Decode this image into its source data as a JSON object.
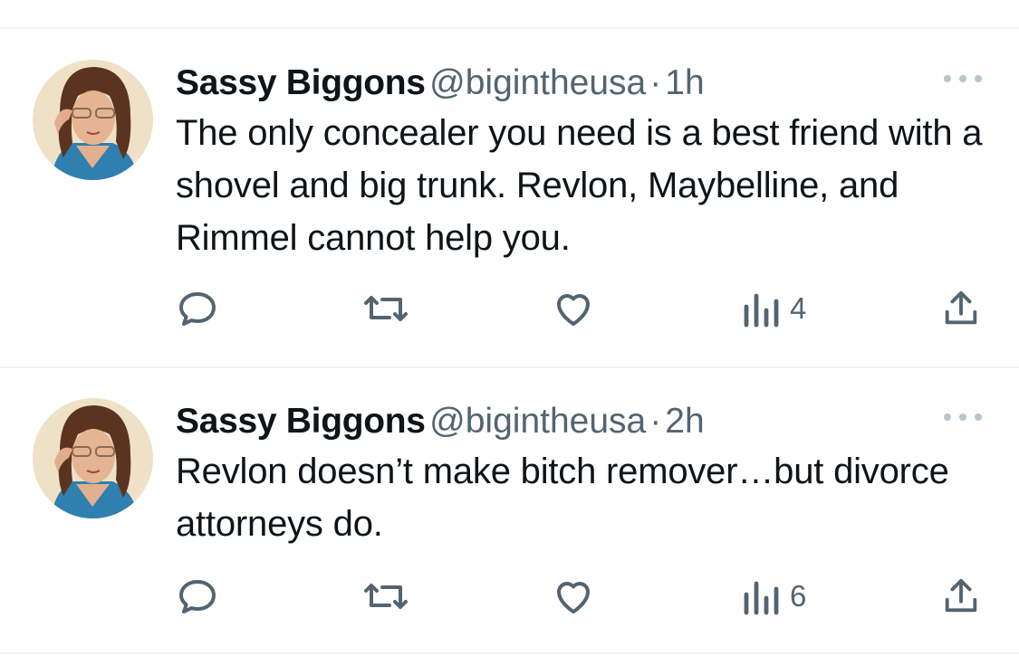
{
  "tweets": [
    {
      "author": "Sassy Biggons",
      "handle": "@bigintheusa",
      "separator": "·",
      "time": "1h",
      "text": "The only concealer you need is a best friend with a shovel and big trunk. Revlon, Maybelline, and Rimmel cannot help you.",
      "views": "4"
    },
    {
      "author": "Sassy Biggons",
      "handle": "@bigintheusa",
      "separator": "·",
      "time": "2h",
      "text": "Revlon doesn’t make bitch remover…but divorce attorneys do.",
      "views": "6"
    }
  ],
  "icons": {
    "reply": "reply-icon",
    "retweet": "retweet-icon",
    "like": "heart-icon",
    "views": "analytics-icon",
    "share": "share-icon",
    "more": "more-icon"
  },
  "colors": {
    "text": "#0f1419",
    "secondary": "#536471",
    "icon": "#536471",
    "divider": "#eff3f4"
  }
}
